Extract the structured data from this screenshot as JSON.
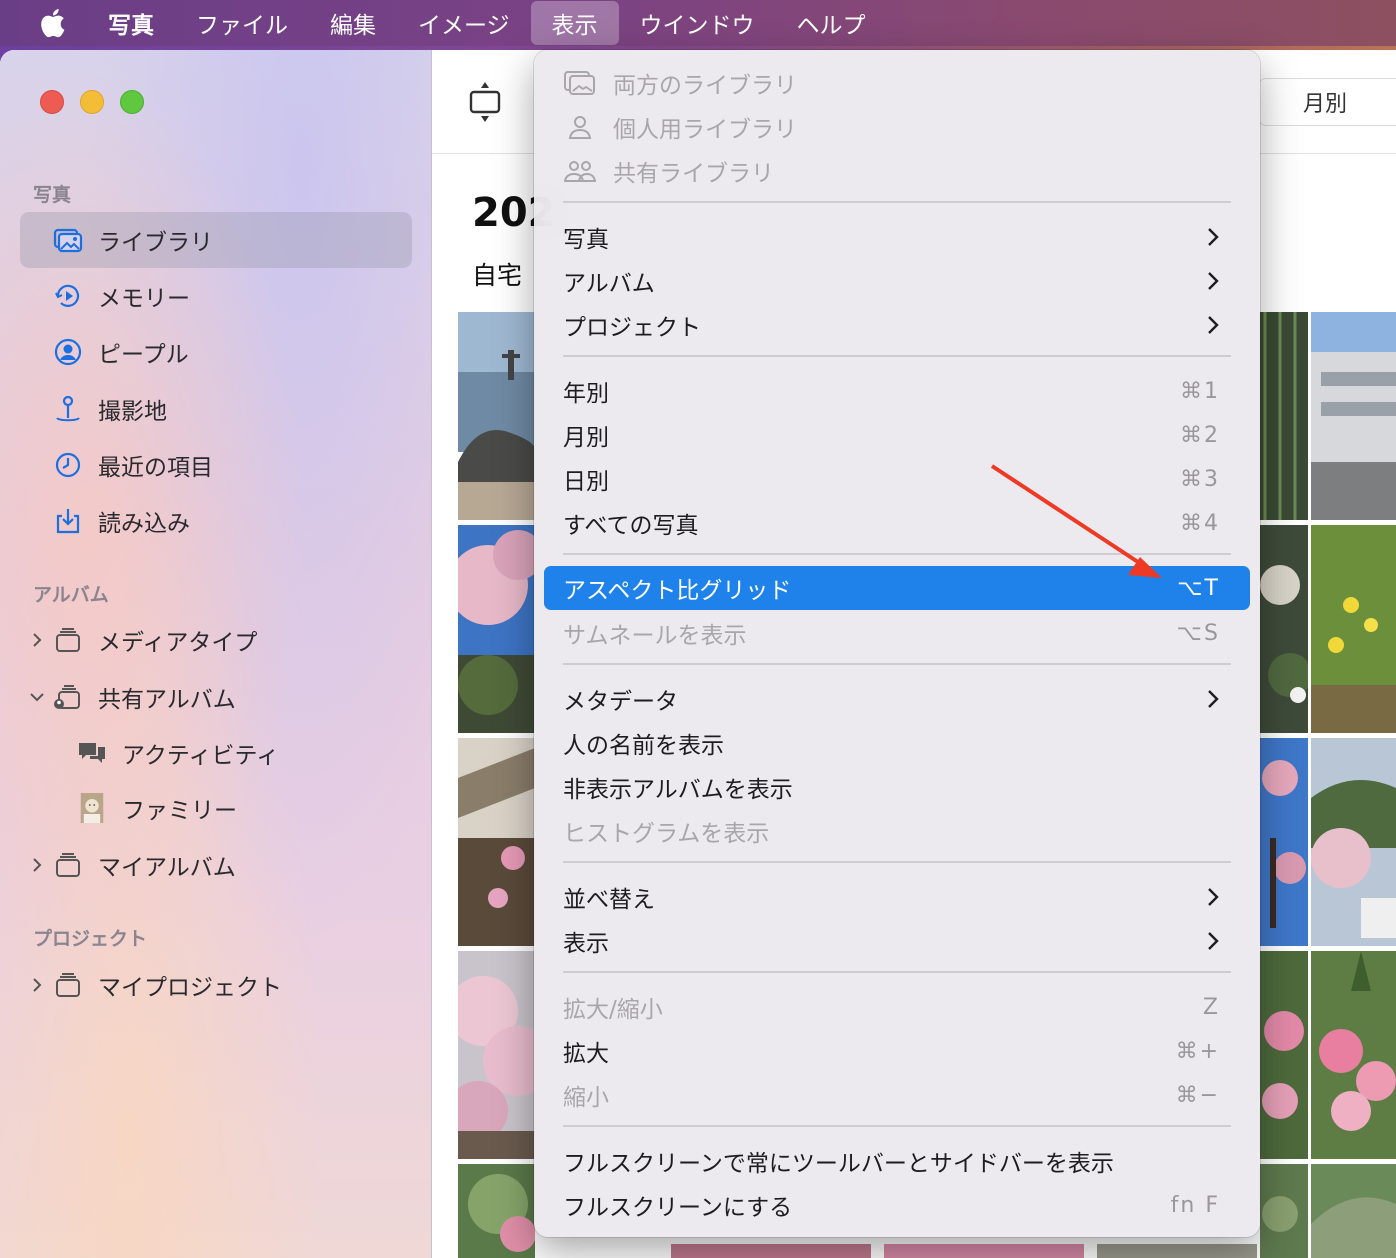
{
  "menubar": {
    "app": "写真",
    "items": [
      "ファイル",
      "編集",
      "イメージ",
      "表示",
      "ウインドウ",
      "ヘルプ"
    ],
    "active_index": 3
  },
  "sidebar": {
    "section_photos": "写真",
    "items": [
      {
        "label": "ライブラリ",
        "icon": "library-icon"
      },
      {
        "label": "メモリー",
        "icon": "memories-icon"
      },
      {
        "label": "ピープル",
        "icon": "people-icon"
      },
      {
        "label": "撮影地",
        "icon": "places-icon"
      },
      {
        "label": "最近の項目",
        "icon": "recents-icon"
      },
      {
        "label": "読み込み",
        "icon": "imports-icon"
      }
    ],
    "section_albums": "アルバム",
    "albums": [
      {
        "label": "メディアタイプ"
      },
      {
        "label": "共有アルバム"
      },
      {
        "label": "アクティビティ"
      },
      {
        "label": "ファミリー"
      },
      {
        "label": "マイアルバム"
      }
    ],
    "section_projects": "プロジェクト",
    "projects": [
      {
        "label": "マイプロジェクト"
      }
    ]
  },
  "main": {
    "view_label": "月別",
    "year_title": "202",
    "place_title": "自宅"
  },
  "menu": {
    "library_items": [
      "両方のライブラリ",
      "個人用ライブラリ",
      "共有ライブラリ"
    ],
    "photos": "写真",
    "albums": "アルバム",
    "projects": "プロジェクト",
    "years": "年別",
    "years_shortcut": "⌘1",
    "months": "月別",
    "months_shortcut": "⌘2",
    "days": "日別",
    "days_shortcut": "⌘3",
    "all_photos": "すべての写真",
    "all_photos_shortcut": "⌘4",
    "aspect_grid": "アスペクト比グリッド",
    "aspect_grid_shortcut": "⌥T",
    "show_thumbnails": "サムネールを表示",
    "show_thumbnails_shortcut": "⌥S",
    "metadata": "メタデータ",
    "show_names": "人の名前を表示",
    "show_hidden": "非表示アルバムを表示",
    "show_histogram": "ヒストグラムを表示",
    "sort": "並べ替え",
    "display": "表示",
    "zoom": "拡大/縮小",
    "zoom_shortcut": "Z",
    "zoom_in": "拡大",
    "zoom_in_shortcut": "⌘+",
    "zoom_out": "縮小",
    "zoom_out_shortcut": "⌘−",
    "fullscreen_toolbar": "フルスクリーンで常にツールバーとサイドバーを表示",
    "fullscreen": "フルスクリーンにする",
    "fullscreen_shortcut": "fn F"
  },
  "colors": {
    "highlight": "#1e82ea",
    "annotation_arrow": "#ee3a24"
  }
}
